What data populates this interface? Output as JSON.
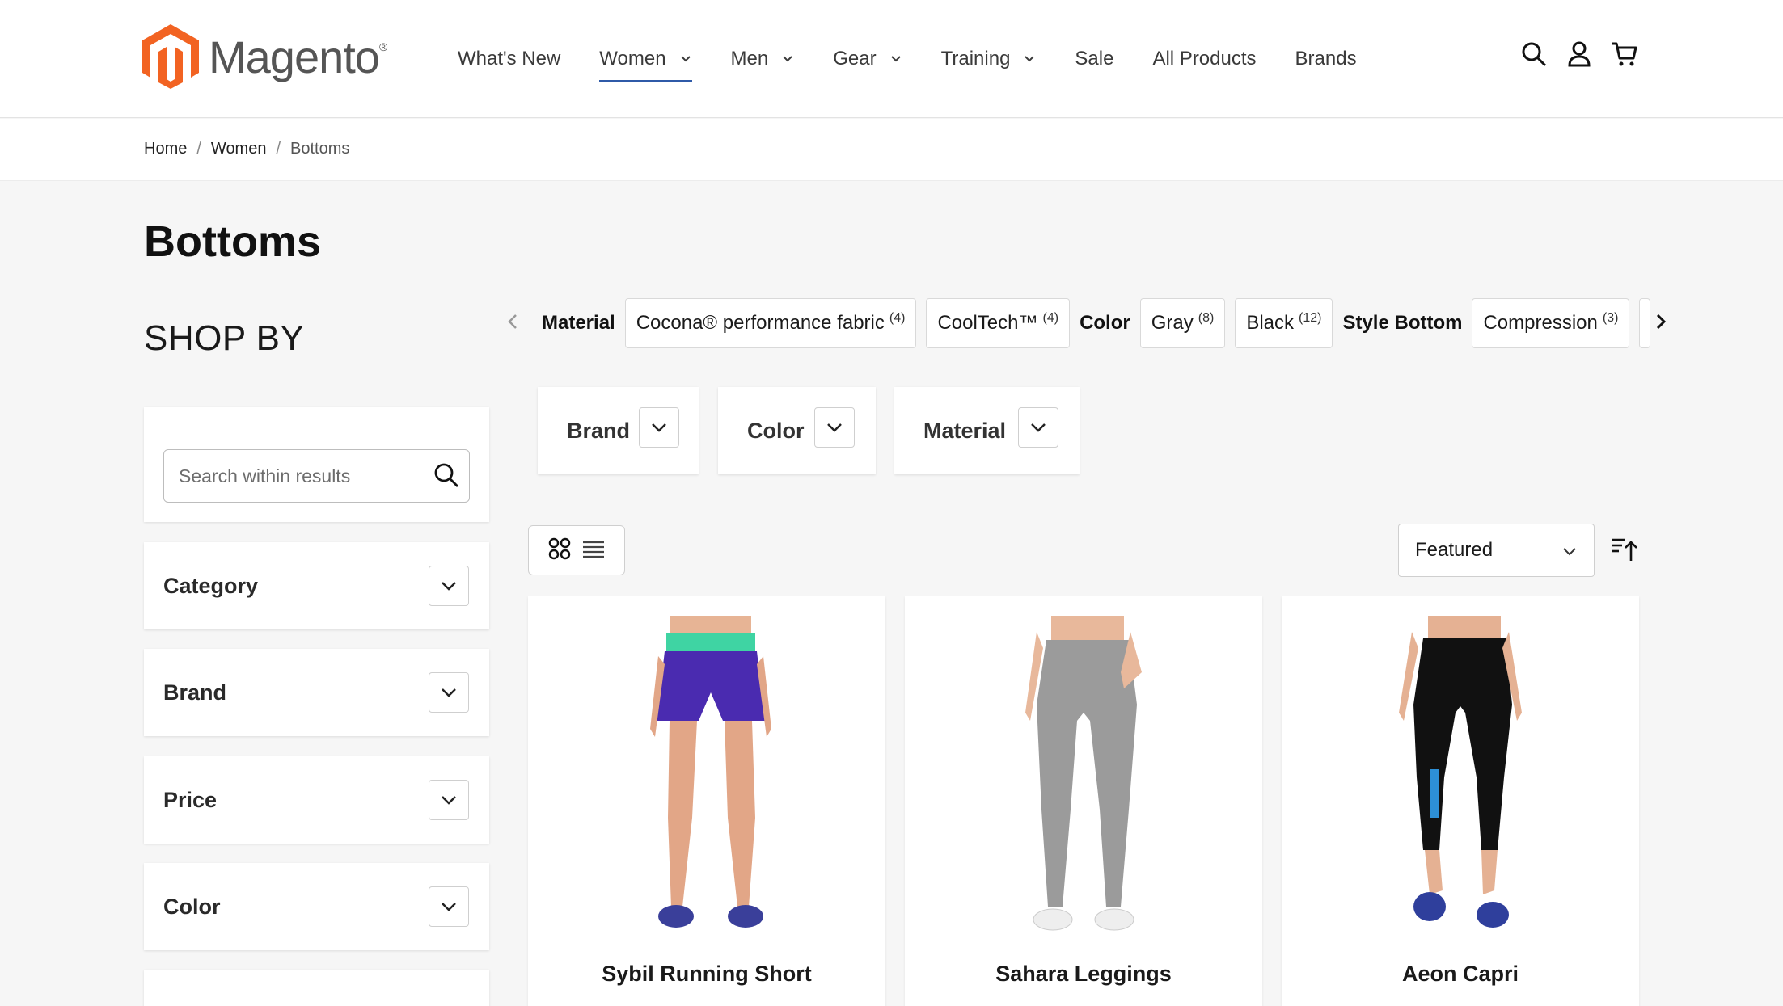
{
  "header": {
    "logo_text": "Magento",
    "nav": [
      {
        "label": "What's New",
        "dropdown": false,
        "active": false
      },
      {
        "label": "Women",
        "dropdown": true,
        "active": true
      },
      {
        "label": "Men",
        "dropdown": true,
        "active": false
      },
      {
        "label": "Gear",
        "dropdown": true,
        "active": false
      },
      {
        "label": "Training",
        "dropdown": true,
        "active": false
      },
      {
        "label": "Sale",
        "dropdown": false,
        "active": false
      },
      {
        "label": "All Products",
        "dropdown": false,
        "active": false
      },
      {
        "label": "Brands",
        "dropdown": false,
        "active": false
      }
    ],
    "icons": [
      "search-icon",
      "account-icon",
      "cart-icon"
    ]
  },
  "breadcrumb": {
    "items": [
      "Home",
      "Women",
      "Bottoms"
    ],
    "separator": "/"
  },
  "page_title": "Bottoms",
  "sidebar": {
    "heading": "SHOP BY",
    "search_placeholder": "Search within results",
    "filters": [
      "Category",
      "Brand",
      "Price",
      "Color"
    ]
  },
  "applied_filters": {
    "groups": [
      {
        "label": "Material",
        "options": [
          {
            "name": "Cocona® performance fabric",
            "count": "(4)"
          },
          {
            "name": "CoolTech™",
            "count": "(4)"
          }
        ]
      },
      {
        "label": "Color",
        "options": [
          {
            "name": "Gray",
            "count": "(8)"
          },
          {
            "name": "Black",
            "count": "(12)"
          }
        ]
      },
      {
        "label": "Style Bottom",
        "options": [
          {
            "name": "Compression",
            "count": "(3)"
          }
        ]
      }
    ]
  },
  "top_filters": [
    "Brand",
    "Color",
    "Material"
  ],
  "toolbar": {
    "sort_value": "Featured",
    "view_modes": [
      "grid",
      "list"
    ]
  },
  "products": [
    {
      "name": "Sybil Running Short"
    },
    {
      "name": "Sahara Leggings"
    },
    {
      "name": "Aeon Capri"
    }
  ],
  "colors": {
    "brand_orange": "#f26322",
    "nav_active_underline": "#2f5aa8",
    "page_bg": "#f6f6f6"
  }
}
